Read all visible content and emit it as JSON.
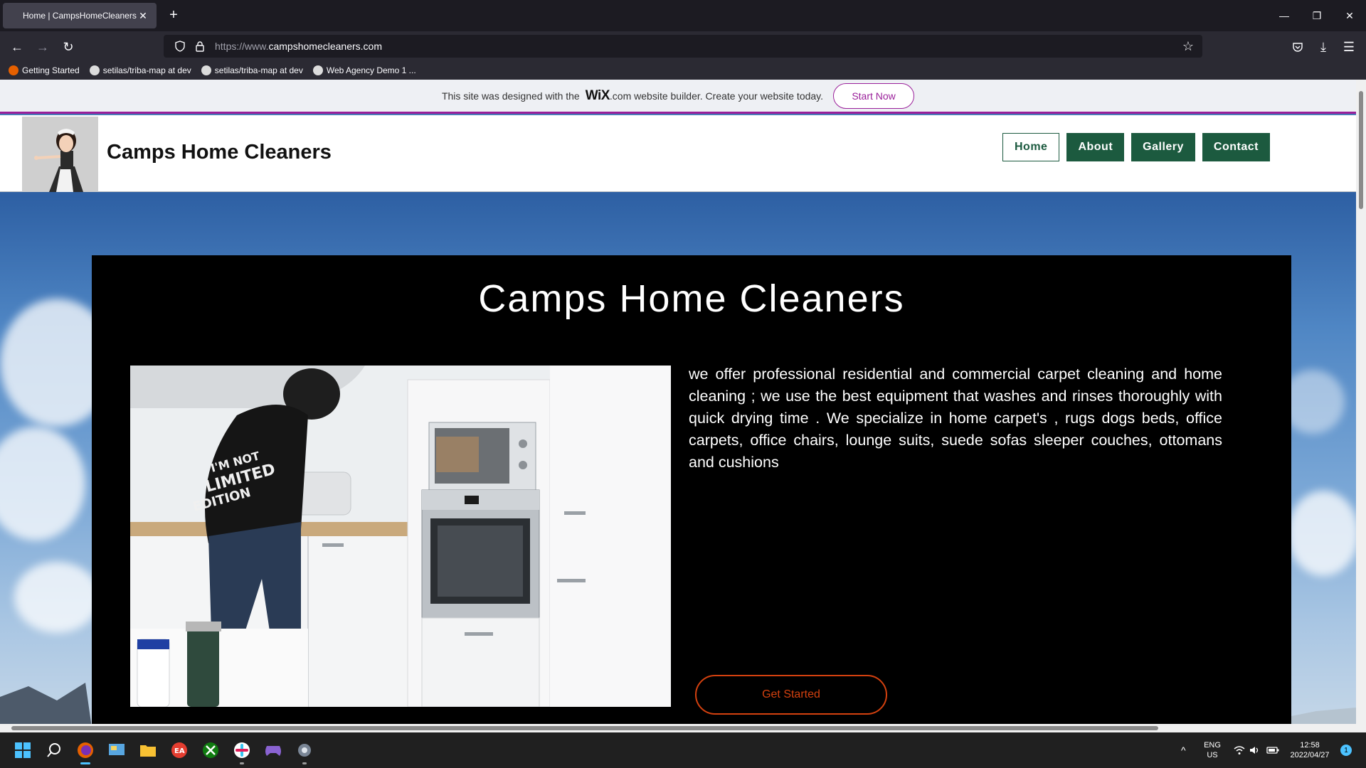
{
  "browser": {
    "tab_title": "Home | CampsHomeCleaners |",
    "url_prefix": "https://www.",
    "url_host": "campshomecleaners.com",
    "bookmarks": [
      {
        "label": "Getting Started",
        "icon": "firefox-icon",
        "color": "#e66000"
      },
      {
        "label": "setilas/triba-map at dev",
        "icon": "github-icon",
        "color": "#dcdcdc"
      },
      {
        "label": "setilas/triba-map at dev",
        "icon": "github-icon",
        "color": "#dcdcdc"
      },
      {
        "label": "Web Agency Demo 1 ...",
        "icon": "wordpress-icon",
        "color": "#dcdcdc"
      }
    ]
  },
  "wix_banner": {
    "text_before": "This site was designed with the",
    "logo": "WiX",
    "text_after": ".com website builder. Create your website today.",
    "button": "Start Now"
  },
  "header": {
    "site_title": "Camps Home Cleaners",
    "menu": [
      "Home",
      "About",
      "Gallery",
      "Contact"
    ]
  },
  "hero": {
    "title": "Camps Home Cleaners",
    "description": "we offer professional residential and commercial carpet cleaning and home cleaning ; we use  the best equipment that washes and rinses thoroughly with quick drying time . We specialize in home carpet's , rugs dogs beds, office carpets, office  chairs, lounge suits, suede sofas sleeper couches, ottomans and cushions",
    "cta": "Get Started"
  },
  "taskbar": {
    "lang_top": "ENG",
    "lang_bottom": "US",
    "time": "12:58",
    "date": "2022/04/27",
    "notifications": "1"
  },
  "colors": {
    "accent_green": "#1c5a3f",
    "wix_purple": "#9a1f9a",
    "cta_orange": "#d4410f"
  }
}
